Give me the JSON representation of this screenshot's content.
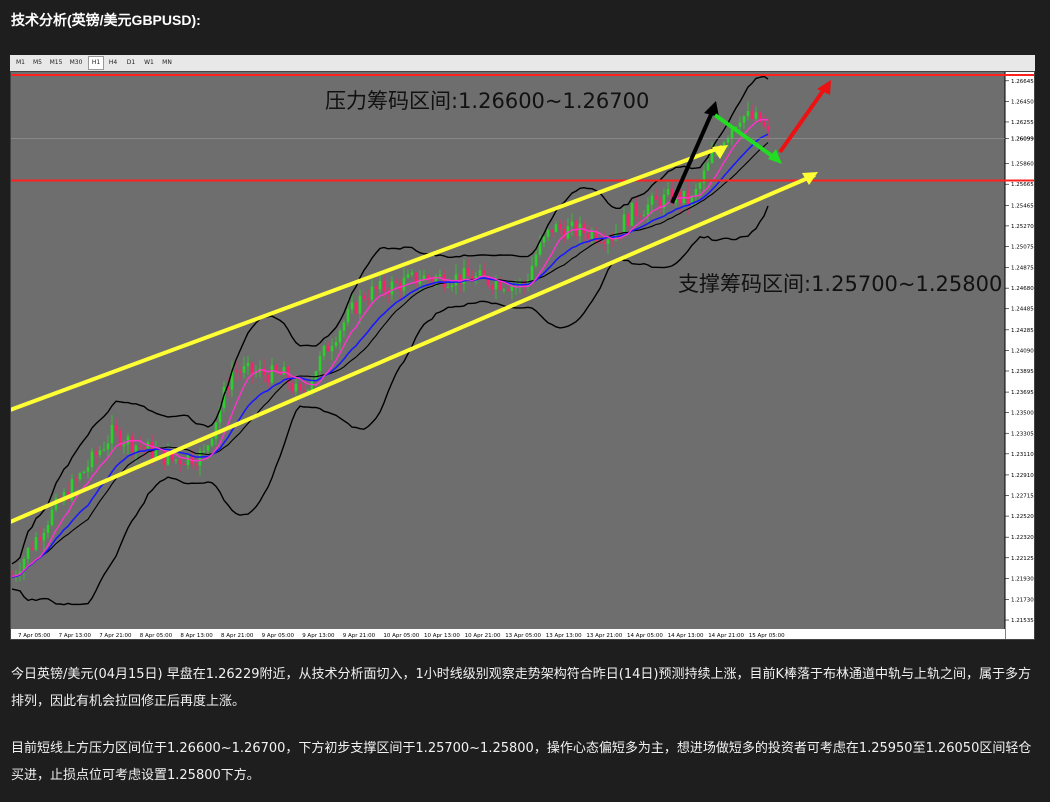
{
  "heading": "技术分析(英镑/美元GBPUSD):",
  "timeframes": [
    "M1",
    "M5",
    "M15",
    "M30",
    "H1",
    "H4",
    "D1",
    "W1",
    "MN"
  ],
  "active_timeframe": "H1",
  "chart_data": {
    "type": "candlestick",
    "symbol": "GBPUSD",
    "timeframe": "H1",
    "ylim": [
      1.2145,
      1.267
    ],
    "y_ticks": [
      "1.26645",
      "1.26450",
      "1.26255",
      "1.26099",
      "1.25860",
      "1.25665",
      "1.25465",
      "1.25270",
      "1.25075",
      "1.24875",
      "1.24680",
      "1.24485",
      "1.24285",
      "1.24090",
      "1.23895",
      "1.23695",
      "1.23500",
      "1.23305",
      "1.23110",
      "1.22910",
      "1.22715",
      "1.22520",
      "1.22320",
      "1.22125",
      "1.21930",
      "1.21730",
      "1.21535"
    ],
    "x_ticks": [
      "7 Apr 05:00",
      "7 Apr 13:00",
      "7 Apr 21:00",
      "8 Apr 05:00",
      "8 Apr 13:00",
      "8 Apr 21:00",
      "9 Apr 05:00",
      "9 Apr 13:00",
      "9 Apr 21:00",
      "10 Apr 05:00",
      "10 Apr 13:00",
      "10 Apr 21:00",
      "13 Apr 05:00",
      "13 Apr 13:00",
      "13 Apr 21:00",
      "14 Apr 05:00",
      "14 Apr 13:00",
      "14 Apr 21:00",
      "15 Apr 05:00"
    ],
    "current_price": 1.26099,
    "resistance_lines": [
      1.267,
      1.257
    ],
    "annotations": {
      "resistance": "压力筹码区间:1.26600~1.26700",
      "support": "支撑筹码区间:1.25700~1.25800"
    },
    "colors": {
      "background": "#6e6e6e",
      "bull": "#2ad12a",
      "bear": "#ff1e6e",
      "channel": "#ffff33",
      "level_line": "#ff2020",
      "ma_fast": "#ff33cc",
      "ma_slow": "#1a1aff",
      "bollinger": "#000000"
    }
  },
  "paragraphs": [
    "今日英镑/美元(04月15日) 早盘在1.26229附近，从技术分析面切入，1小时线级别观察走势架构符合昨日(14日)预测持续上涨，目前K棒落于布林通道中轨与上轨之间，属于多方排列，因此有机会拉回修正后再度上涨。",
    "目前短线上方压力区间位于1.26600~1.26700，下方初步支撑区间于1.25700~1.25800，操作心态偏短多为主，想进场做短多的投资者可考虑在1.25950至1.26050区间轻仓买进，止损点位可考虑设置1.25800下方。"
  ]
}
